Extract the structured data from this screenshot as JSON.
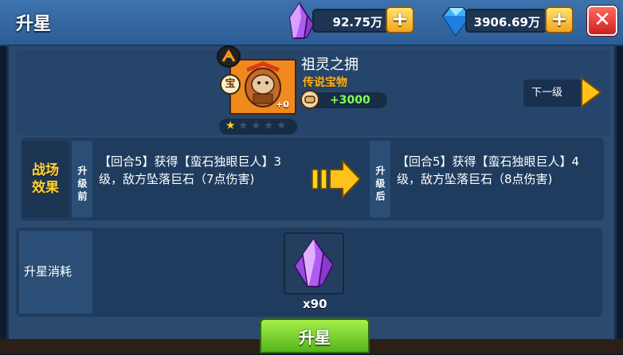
{
  "header": {
    "title": "升星",
    "crystal_amount": "92.75万",
    "diamond_amount": "3906.69万"
  },
  "item": {
    "name": "祖灵之拥",
    "rarity": "传说宝物",
    "badge": "宝",
    "level": "+0",
    "power": "+3000",
    "stars_filled": 1,
    "stars_total": 5,
    "next_label": "下一级"
  },
  "effect": {
    "title": "战场效果",
    "before_tag": "升级前",
    "after_tag": "升级后",
    "before_text": "【回合5】获得【蛮石独眼巨人】3级，敌方坠落巨石（7点伤害)",
    "after_text": "【回合5】获得【蛮石独眼巨人】4级，敌方坠落巨石（8点伤害)"
  },
  "cost": {
    "label": "升星消耗",
    "count": "x90"
  },
  "action": {
    "upgrade_label": "升星"
  },
  "colors": {
    "accent_yellow": "#ffd23a",
    "rarity_orange": "#ffb21d",
    "power_green": "#7dff5b",
    "button_green": "#55b41c"
  }
}
